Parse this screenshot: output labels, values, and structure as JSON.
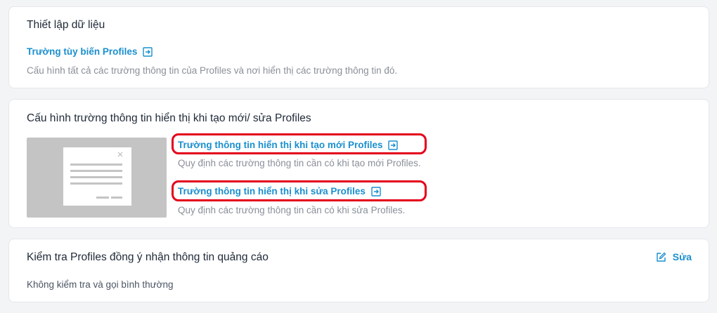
{
  "data_setup": {
    "title": "Thiết lập dữ liệu",
    "link_label": "Trường tùy biến Profiles",
    "description": "Cấu hình tất cả các trường thông tin của Profiles và nơi hiển thị các trường thông tin đó."
  },
  "field_config": {
    "title": "Cấu hình trường thông tin hiển thị khi tạo mới/ sửa Profiles",
    "create_link_label": "Trường thông tin hiển thị khi tạo mới Profiles",
    "create_description": "Quy định các trường thông tin cần có khi tạo mới Profiles.",
    "edit_link_label": "Trường thông tin hiển thị khi sửa Profiles",
    "edit_description": "Quy định các trường thông tin cần có khi sửa Profiles."
  },
  "ad_consent": {
    "title": "Kiểm tra Profiles đồng ý nhận thông tin quảng cáo",
    "edit_label": "Sửa",
    "value": "Không kiểm tra và gọi bình thường"
  },
  "icons": {
    "external_link": "external-link-icon",
    "edit": "edit-pencil-icon",
    "form_illustration": "form-illustration"
  },
  "colors": {
    "link": "#1a8fce",
    "highlight": "#e4001b",
    "thumbnail": "#c4c4c4"
  }
}
